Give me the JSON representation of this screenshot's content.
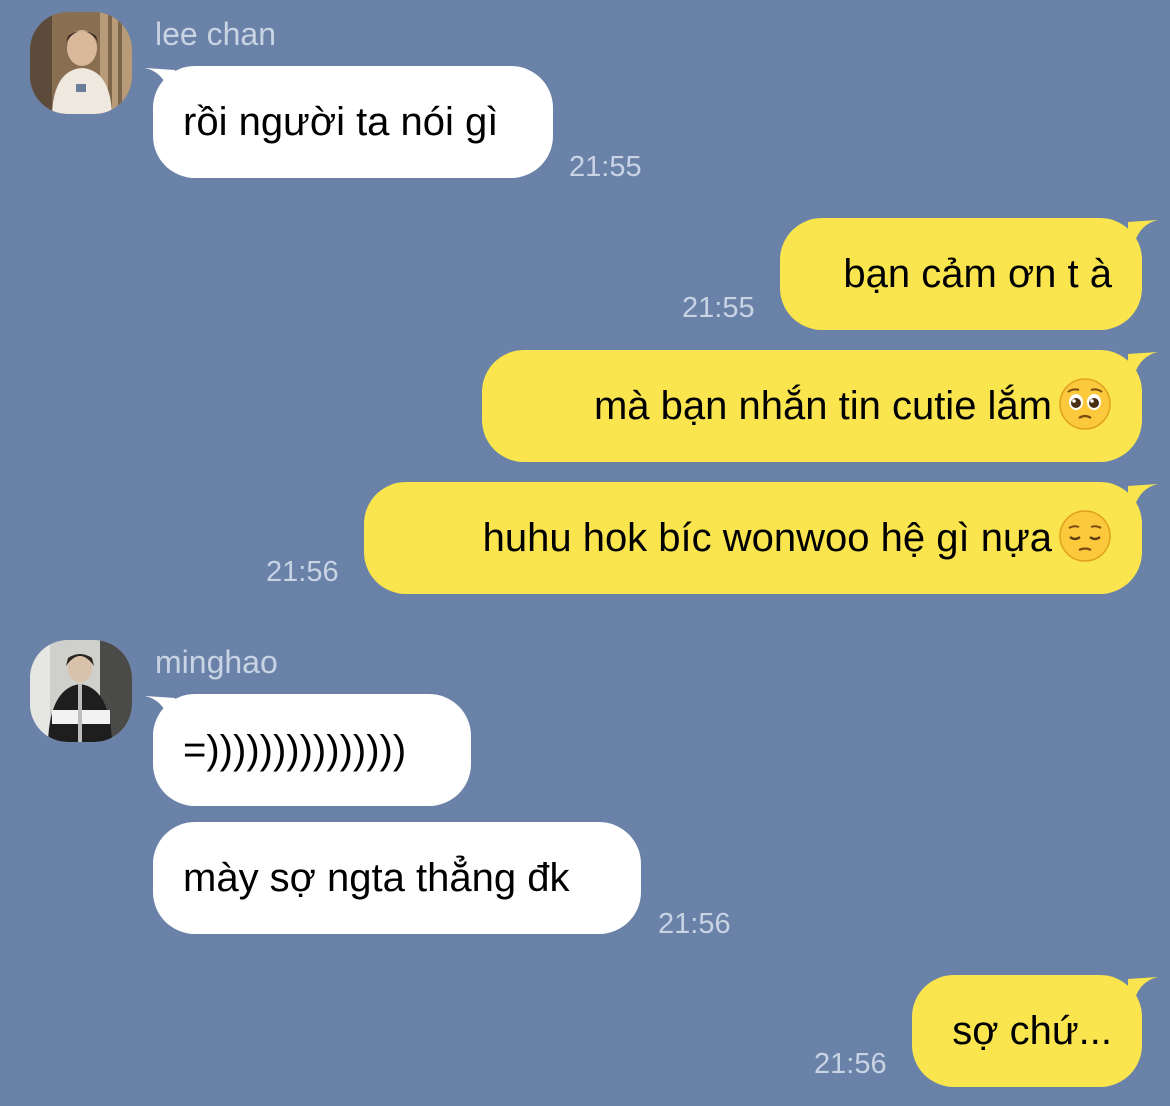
{
  "colors": {
    "background": "#6b82a8",
    "incoming_bubble": "#ffffff",
    "outgoing_bubble": "#fae54e",
    "meta_text": "#c8d3e4"
  },
  "messages": [
    {
      "sender": "lee chan",
      "text": "rồi người ta nói gì",
      "time": "21:55",
      "direction": "incoming"
    },
    {
      "text": "bạn cảm ơn t à",
      "time": "21:55",
      "direction": "outgoing"
    },
    {
      "text": "mà bạn nhắn tin cutie lắm",
      "emoji": "pleading-face-icon",
      "direction": "outgoing"
    },
    {
      "text": "huhu hok bíc wonwoo hệ gì nựa",
      "emoji": "pensive-face-icon",
      "time": "21:56",
      "direction": "outgoing"
    },
    {
      "sender": "minghao",
      "text": "=)))))))))))))))",
      "direction": "incoming"
    },
    {
      "text": "mày sợ ngta thẳng đk",
      "time": "21:56",
      "direction": "incoming"
    },
    {
      "text": "sợ chứ...",
      "time": "21:56",
      "direction": "outgoing"
    }
  ]
}
